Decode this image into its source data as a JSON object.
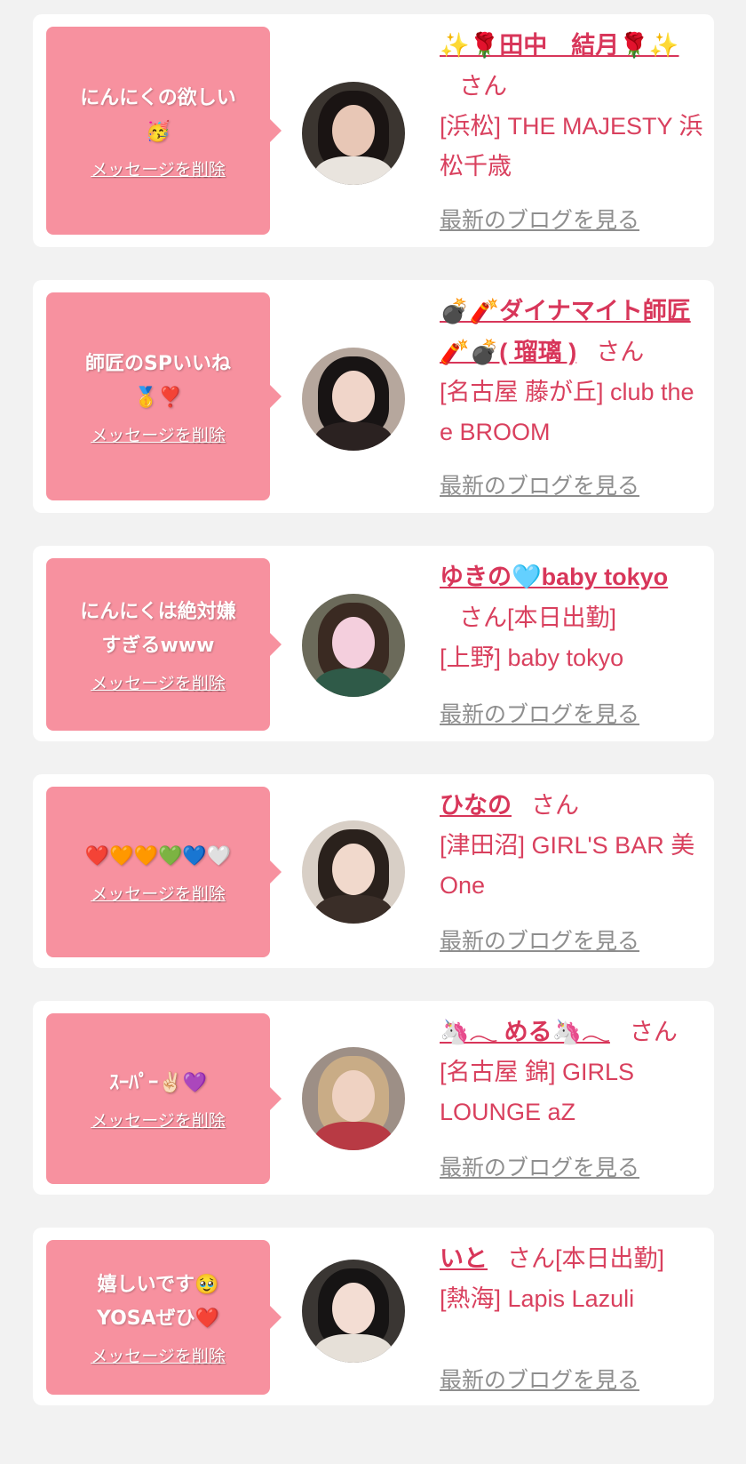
{
  "delete_label": "メッセージを削除",
  "blog_label": "最新のブログを見る",
  "san_label": "さん",
  "colors": {
    "bubble": "#f7919f",
    "name": "#d8365a",
    "text": "#d9405e",
    "link": "#8e8e8e"
  },
  "messages": [
    {
      "message": "にんにくの欲しい\n🥳",
      "name": "✨🌹田中　結月🌹✨",
      "suffix": "",
      "shop": "[浜松] THE MAJESTY 浜松千歳",
      "avatar": {
        "bg": "#3b3530",
        "hair": "#1a1413",
        "face": "#e8c7b6",
        "body": "#e9e4de"
      }
    },
    {
      "message": "師匠のSPいいね\n🥇❣️",
      "name": "💣🧨ダイナマイト師匠🧨💣( 瑠璃 )",
      "suffix": "",
      "shop": "[名古屋 藤が丘] club the e BROOM",
      "avatar": {
        "bg": "#b6a79d",
        "hair": "#181414",
        "face": "#f0d5c9",
        "body": "#2b2221"
      }
    },
    {
      "message": "にんにくは絶対嫌\nすぎるwww",
      "name": "ゆきの🩵baby tokyo",
      "suffix": "[本日出勤]",
      "shop": "[上野] baby tokyo",
      "avatar": {
        "bg": "#6b6a5a",
        "hair": "#3a2a22",
        "face": "#f4cfdd",
        "body": "#2f5a48"
      }
    },
    {
      "message": "❤️🧡🧡💚💙🤍",
      "name": "ひなの",
      "suffix": "",
      "shop": "[津田沼] GIRL'S BAR 美One",
      "avatar": {
        "bg": "#d8cfc6",
        "hair": "#2a211c",
        "face": "#f1d9cc",
        "body": "#3a2e28"
      }
    },
    {
      "message": "ｽｰﾊﾟｰ✌🏻💜",
      "name": "🦄𓂃 める🦄𓂃",
      "suffix": "",
      "shop": "[名古屋 錦] GIRLS LOUNGE aZ",
      "avatar": {
        "bg": "#9d8f86",
        "hair": "#c9ac86",
        "face": "#efd2c2",
        "body": "#b83a44"
      }
    },
    {
      "message": "嬉しいです🥹\nYOSAぜひ❤️",
      "name": "いと",
      "suffix": "[本日出勤]",
      "shop": "[熱海] Lapis Lazuli",
      "avatar": {
        "bg": "#3a3633",
        "hair": "#161414",
        "face": "#f3ddd3",
        "body": "#e6e0d8"
      }
    }
  ]
}
